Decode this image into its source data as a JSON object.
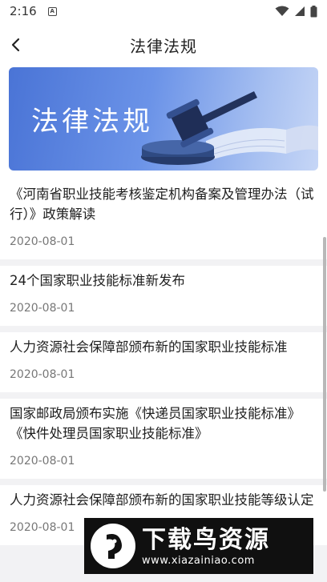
{
  "status_bar": {
    "time": "2:16",
    "notification_badge": "A"
  },
  "app_bar": {
    "title": "法律法规"
  },
  "banner": {
    "text": "法律法规"
  },
  "articles": [
    {
      "title": "《河南省职业技能考核鉴定机构备案及管理办法（试行）》政策解读",
      "date": "2020-08-01"
    },
    {
      "title": "24个国家职业技能标准新发布",
      "date": "2020-08-01"
    },
    {
      "title": "人力资源社会保障部颁布新的国家职业技能标准",
      "date": "2020-08-01"
    },
    {
      "title": "国家邮政局颁布实施《快递员国家职业技能标准》《快件处理员国家职业技能标准》",
      "date": "2020-08-01"
    },
    {
      "title": "人力资源社会保障部颁布新的国家职业技能等级认定",
      "date": "2020-08-01"
    }
  ],
  "watermark": {
    "name": "下载鸟资源",
    "url": "www.xiazainiao.com"
  },
  "colors": {
    "banner_start": "#4a74d6",
    "banner_end": "#c6d6f6",
    "date_text": "#777777"
  }
}
